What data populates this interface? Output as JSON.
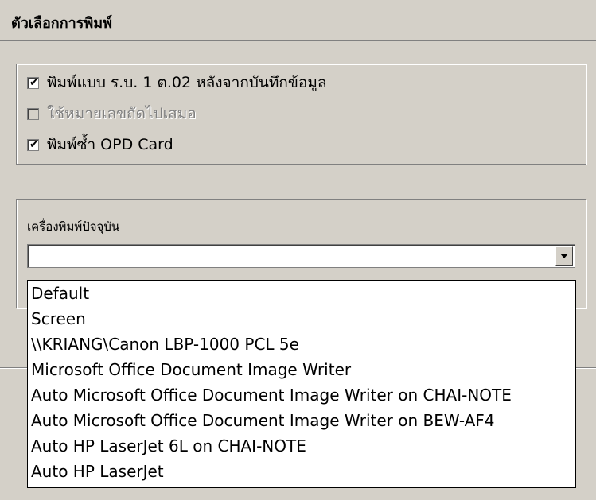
{
  "title": "ตัวเลือกการพิมพ์",
  "options": [
    {
      "label": "พิมพ์แบบ ร.บ. 1 ต.02 หลังจากบันทึกข้อมูล",
      "checked": true,
      "enabled": true
    },
    {
      "label": "ใช้หมายเลขถัดไปเสมอ",
      "checked": false,
      "enabled": false
    },
    {
      "label": "พิมพ์ซ้ำ OPD Card",
      "checked": true,
      "enabled": true
    }
  ],
  "printer": {
    "label": "เครื่องพิมพ์ปัจจุบัน",
    "value": "",
    "options": [
      "Default",
      "Screen",
      "\\\\KRIANG\\Canon LBP-1000 PCL 5e",
      "Microsoft Office Document Image Writer",
      "Auto Microsoft Office Document Image Writer on CHAI-NOTE",
      "Auto Microsoft Office Document Image Writer on BEW-AF4",
      "Auto HP LaserJet 6L on CHAI-NOTE",
      "Auto HP LaserJet"
    ]
  },
  "icons": {
    "check": "check-icon",
    "dropdown": "dropdown-arrow-icon"
  }
}
